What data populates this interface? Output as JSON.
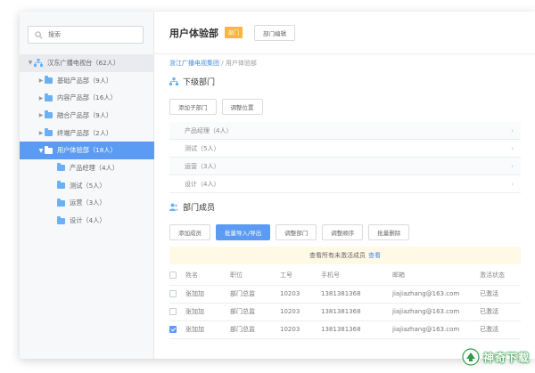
{
  "search": {
    "placeholder": "搜索"
  },
  "tree": {
    "root": "汉东广播电视台（62人）",
    "items": [
      {
        "label": "基础产品部（9人）",
        "expanded": false
      },
      {
        "label": "内容产品部（16人）",
        "expanded": false
      },
      {
        "label": "融合产品部（9人）",
        "expanded": false
      },
      {
        "label": "终端产品部（2人）",
        "expanded": false
      },
      {
        "label": "用户体验部（18人）",
        "expanded": true,
        "selected": true
      }
    ],
    "children": [
      {
        "label": "产品经理（4人）"
      },
      {
        "label": "测试（5人）"
      },
      {
        "label": "运营（3人）"
      },
      {
        "label": "设计（4人）"
      }
    ]
  },
  "header": {
    "title": "用户体验部",
    "badge": "部门",
    "edit_button": "部门编辑"
  },
  "breadcrumb": {
    "root": "浙江广播电视集团",
    "separator": "/",
    "current": "用户体验部"
  },
  "sub_departments": {
    "title": "下级部门",
    "add_button": "添加子部门",
    "reorder_button": "调整位置",
    "items": [
      {
        "label": "产品经理（4人）"
      },
      {
        "label": "测试（5人）"
      },
      {
        "label": "运营（3人）"
      },
      {
        "label": "设计（4人）"
      }
    ]
  },
  "members": {
    "title": "部门成员",
    "buttons": {
      "add": "添加成员",
      "import_export": "批量导入/导出",
      "move": "调整部门",
      "order": "调整顺序",
      "delete": "批量删除"
    },
    "notice": {
      "text": "查看所有未激活成员",
      "link": "查看"
    },
    "columns": [
      "姓名",
      "职位",
      "工号",
      "手机号",
      "邮箱",
      "激活状态"
    ],
    "rows": [
      {
        "name": "张加加",
        "title": "部门总监",
        "id": "10203",
        "phone": "1381381368",
        "email": "jiajiazhang@163.com",
        "status": "已激活",
        "checked": false
      },
      {
        "name": "张加加",
        "title": "部门总监",
        "id": "10203",
        "phone": "1381381368",
        "email": "jiajiazhang@163.com",
        "status": "已激活",
        "checked": false
      },
      {
        "name": "张加加",
        "title": "部门总监",
        "id": "10203",
        "phone": "1381381368",
        "email": "jiajiazhang@163.com",
        "status": "已激活",
        "checked": true
      }
    ]
  },
  "watermark": {
    "text": "神奇下载"
  },
  "colors": {
    "accent": "#5b9cf2",
    "badge": "#f6b73c",
    "notice_bg": "#fff9e6"
  }
}
